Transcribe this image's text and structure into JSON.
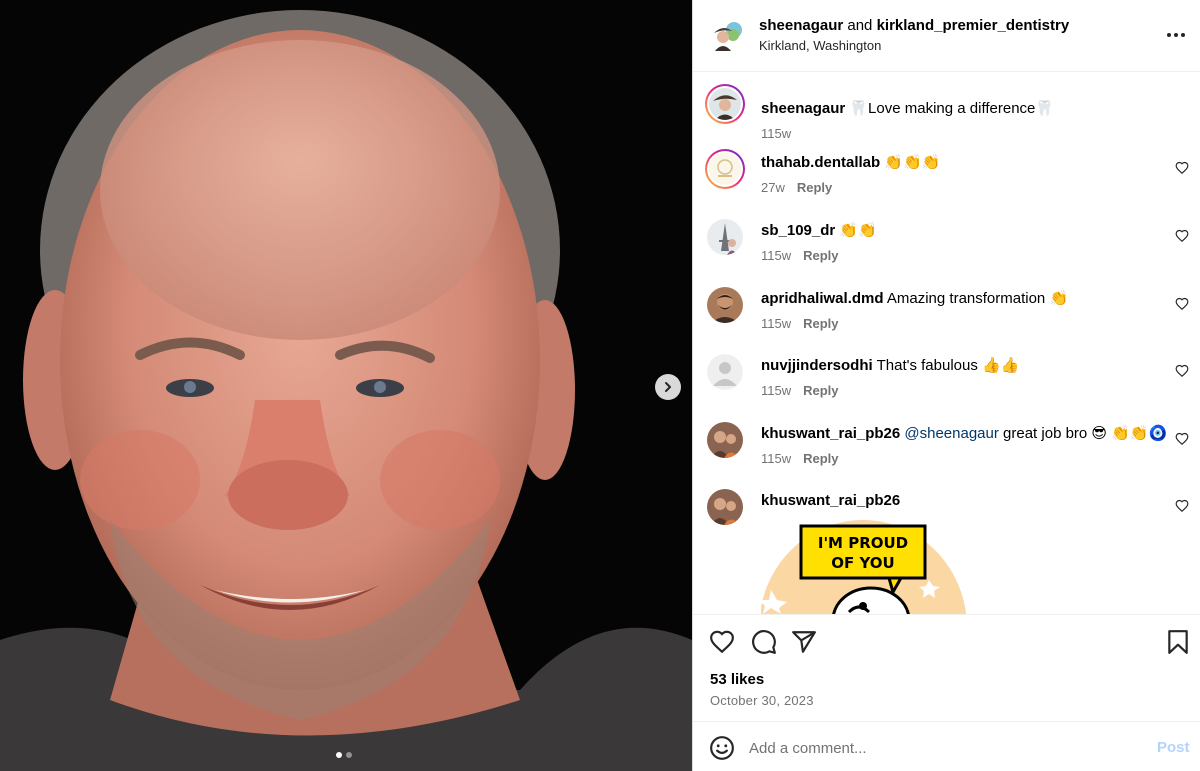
{
  "header": {
    "user1": "sheenagaur",
    "joiner": "and",
    "user2": "kirkland_premier_dentistry",
    "location": "Kirkland, Washington",
    "more_icon": "more-horizontal-icon"
  },
  "caption": {
    "user": "sheenagaur",
    "text": "🦷Love making a difference🦷",
    "time": "115w"
  },
  "comments": [
    {
      "user": "thahab.dentallab",
      "text": "👏👏👏",
      "time": "27w",
      "reply": "Reply"
    },
    {
      "user": "sb_109_dr",
      "text": "👏👏",
      "time": "115w",
      "reply": "Reply"
    },
    {
      "user": "apridhaliwal.dmd",
      "text": "Amazing transformation 👏",
      "time": "115w",
      "reply": "Reply"
    },
    {
      "user": "nuvjjindersodhi",
      "text": "That's fabulous 👍👍",
      "time": "115w",
      "reply": "Reply"
    },
    {
      "user": "khuswant_rai_pb26",
      "mention": "@sheenagaur",
      "text": "great job bro 😎 👏👏🧿",
      "time": "115w",
      "reply": "Reply"
    },
    {
      "user": "khuswant_rai_pb26",
      "sticker_line1": "I'M PROUD",
      "sticker_line2": "OF YOU"
    }
  ],
  "actions": {
    "likes": "53 likes",
    "date": "October 30, 2023"
  },
  "add_comment": {
    "placeholder": "Add a comment...",
    "post_label": "Post"
  },
  "carousel": {
    "current": 1,
    "total": 2
  },
  "colors": {
    "link": "#00376b",
    "muted": "#737373",
    "post_disabled": "#b3d4fc"
  }
}
